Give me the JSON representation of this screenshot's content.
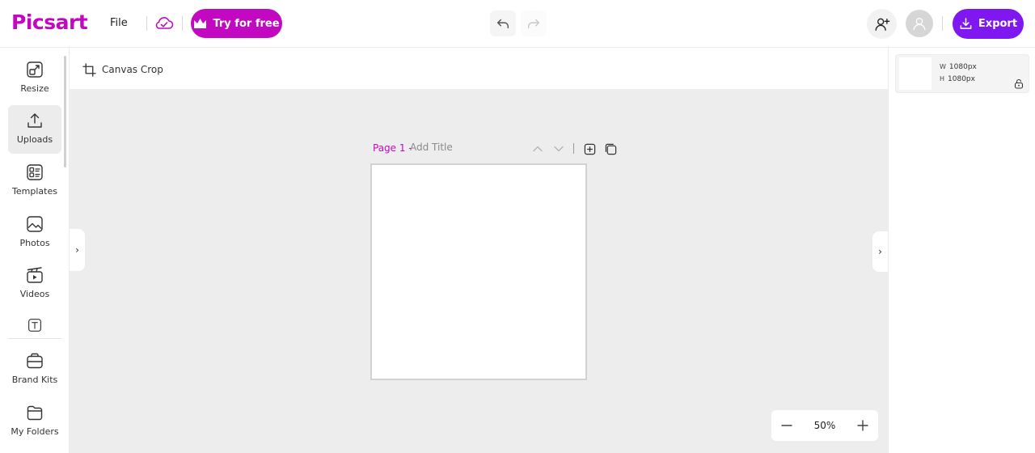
{
  "header": {
    "logo": "Picsart",
    "file_label": "File",
    "try_label": "Try for free",
    "export_label": "Export"
  },
  "sidebar": {
    "items": [
      {
        "label": "Resize",
        "icon": "resize-icon"
      },
      {
        "label": "Uploads",
        "icon": "upload-icon"
      },
      {
        "label": "Templates",
        "icon": "templates-icon"
      },
      {
        "label": "Photos",
        "icon": "photos-icon"
      },
      {
        "label": "Videos",
        "icon": "videos-icon"
      },
      {
        "label": "",
        "icon": "text-icon"
      },
      {
        "label": "Brand Kits",
        "icon": "brand-kit-icon"
      },
      {
        "label": "My Folders",
        "icon": "folder-icon"
      }
    ],
    "active": "Uploads"
  },
  "toolbar": {
    "crop_label": "Canvas Crop"
  },
  "canvas": {
    "page_label": "Page 1 -",
    "title_placeholder": "Add Title"
  },
  "zoom": {
    "value": "50%"
  },
  "right_panel": {
    "width_label": "W",
    "width_value": "1080px",
    "height_label": "H",
    "height_value": "1080px"
  },
  "colors": {
    "brand": "#c209c1",
    "export": "#7f17f0",
    "canvas_bg": "#ededed"
  }
}
